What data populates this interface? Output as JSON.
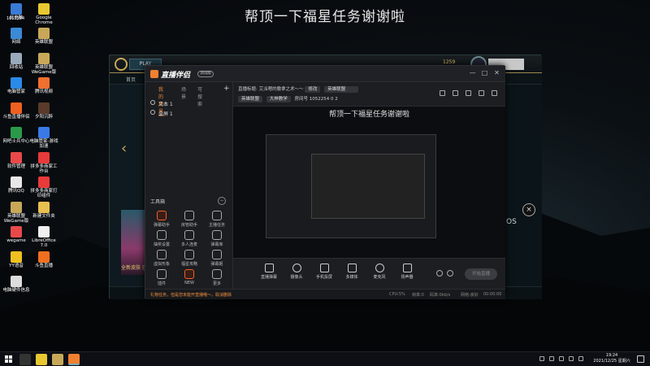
{
  "overlay_title": "帮顶一下福星任务谢谢啦",
  "desktop": {
    "icons": [
      {
        "label": "此电脑",
        "icon": "computer-icon",
        "color": "#3a7bd5"
      },
      {
        "label": "Google Chrome",
        "icon": "chrome-icon",
        "color": "#e8c830"
      },
      {
        "label": "网络",
        "icon": "network-icon",
        "color": "#3a8ad5"
      },
      {
        "label": "英雄联盟",
        "icon": "lol-icon",
        "color": "#c8a858"
      },
      {
        "label": "回收站",
        "icon": "recycle-bin-icon",
        "color": "#9ab"
      },
      {
        "label": "英雄联盟 WeGame版",
        "icon": "lol-wegame-icon",
        "color": "#c8a858"
      },
      {
        "label": "电脑管家",
        "icon": "pc-manager-icon",
        "color": "#2a8ae8"
      },
      {
        "label": "腾讯视频",
        "icon": "tencent-video-icon",
        "color": "#f07030"
      },
      {
        "label": "斗鱼直播伴侣",
        "icon": "douyu-icon",
        "color": "#f06020"
      },
      {
        "label": "夕阳沉醉",
        "icon": "app-icon",
        "color": "#5a3a2a"
      },
      {
        "label": "网吧士兵中心",
        "icon": "netbar-icon",
        "color": "#2a9a4a"
      },
      {
        "label": "电脑管家-游戏加速",
        "icon": "game-accel-icon",
        "color": "#3a7ae8"
      },
      {
        "label": "软件管理",
        "icon": "software-icon",
        "color": "#e84a4a"
      },
      {
        "label": "拼多多商家工作台",
        "icon": "pdd-icon",
        "color": "#e83a3a"
      },
      {
        "label": "腾讯QQ",
        "icon": "qq-icon",
        "color": "#e8e8e8"
      },
      {
        "label": "拼多多商家打印组件",
        "icon": "pdd-print-icon",
        "color": "#e83a3a"
      },
      {
        "label": "英雄联盟 WeGame版",
        "icon": "lol-wegame-icon",
        "color": "#c8a858"
      },
      {
        "label": "新建文件夹",
        "icon": "folder-icon",
        "color": "#e8c050"
      },
      {
        "label": "wegame",
        "icon": "wegame-icon",
        "color": "#e84a4a"
      },
      {
        "label": "LibreOffice 7.0",
        "icon": "libreoffice-icon",
        "color": "#f0f0f0"
      },
      {
        "label": "YY语音",
        "icon": "yy-icon",
        "color": "#f0c020"
      },
      {
        "label": "斗鱼直播",
        "icon": "douyu-live-icon",
        "color": "#f07020"
      },
      {
        "label": "电脑硬件信息",
        "icon": "hardware-icon",
        "color": "#ddd"
      }
    ],
    "counter_label": "1052254"
  },
  "game_client": {
    "play_button": "PLAY",
    "nav": [
      "首页",
      "TFT",
      "收藏",
      "商城"
    ],
    "coins": "1259",
    "left_arrow": "‹",
    "champion_caption": "全新皮肤 已上线",
    "os_label": "OS"
  },
  "app": {
    "brand": "直播伴侣",
    "version": "测试版",
    "window_buttons": [
      "—",
      "□",
      "✕"
    ],
    "tabs": [
      "我的场景",
      "场景",
      "可搜索"
    ],
    "tab_add": "+",
    "sources": [
      {
        "label": "文本 1"
      },
      {
        "label": "全屏 1"
      }
    ],
    "tools_heading": "工具箱",
    "tools_min": "−",
    "tools": [
      {
        "label": "弹幕助手",
        "hot": true
      },
      {
        "label": "房管助手",
        "hot": false
      },
      {
        "label": "主播任务",
        "hot": false
      },
      {
        "label": "抽奖设置",
        "hot": false
      },
      {
        "label": "多人连麦",
        "hot": false
      },
      {
        "label": "弹幕库",
        "hot": false
      },
      {
        "label": "虚拟形象",
        "hot": false
      },
      {
        "label": "福星攻略",
        "hot": false
      },
      {
        "label": "弹幕姬",
        "hot": false
      },
      {
        "label": "插件",
        "hot": false
      },
      {
        "label": "NEW",
        "hot": true
      },
      {
        "label": "更多",
        "hot": false
      }
    ],
    "stream_info": {
      "category_label": "直播分类:",
      "category_value": "英雄联盟",
      "title_label": "直播标题:",
      "title_value": "艾派嗯的撒拿之术～～",
      "edit_btn": "修改",
      "room_label": "房间号",
      "room_id": "1052254",
      "platform_tag": "大神教学",
      "stat_a": "0",
      "stat_b": "2"
    },
    "preview_title": "帮顶一下福星任务谢谢啦",
    "controls": [
      {
        "label": "直播弹幕",
        "icon": "danmaku-icon"
      },
      {
        "label": "摄像头",
        "icon": "camera-icon"
      },
      {
        "label": "手机投屏",
        "icon": "phone-cast-icon"
      },
      {
        "label": "多媒体",
        "icon": "media-icon"
      },
      {
        "label": "麦克风",
        "icon": "mic-icon"
      },
      {
        "label": "扬声器",
        "icon": "speaker-icon"
      }
    ],
    "go_live": "开始直播",
    "status": {
      "message": "礼物任务，但是您未能开直播哦～，取消删除",
      "cpu": "CPU:5%",
      "fps": "帧率:0",
      "bitrate": "码率:0kb/s",
      "net": "网络:良好",
      "time": "00:00:00"
    }
  },
  "taskbar": {
    "apps": [
      {
        "icon": "search-icon",
        "color": "#333"
      },
      {
        "icon": "chrome-icon",
        "color": "#e8c830"
      },
      {
        "icon": "lol-icon",
        "color": "#c8a858"
      },
      {
        "icon": "live-companion-icon",
        "color": "#f08030"
      }
    ],
    "time": "19:24",
    "date": "2021/12/25 星期六"
  }
}
